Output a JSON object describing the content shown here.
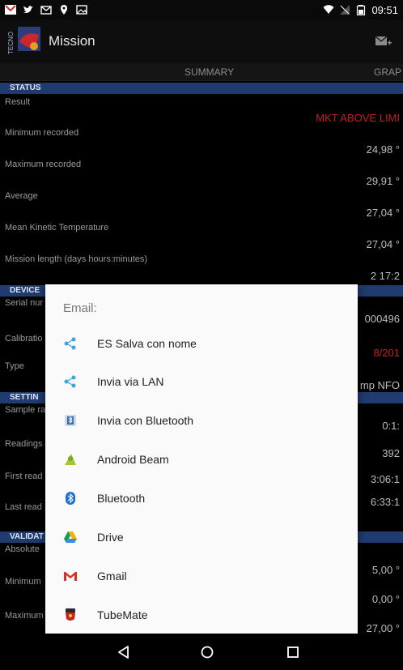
{
  "status_bar": {
    "time": "09:51",
    "left_icons": [
      "gmail-icon",
      "twitter-icon",
      "mail-icon",
      "location-pin-icon",
      "image-icon"
    ],
    "right_icons": [
      "wifi-icon",
      "no-signal-icon",
      "battery-icon"
    ]
  },
  "app_bar": {
    "title": "Mission",
    "logo_text": "TECNO"
  },
  "tabs": [
    "SUMMARY",
    "GRAP"
  ],
  "sections": {
    "status": {
      "header": "STATUS",
      "rows": [
        {
          "label": "Result",
          "value": "MKT ABOVE LIMI",
          "highlight": "red"
        },
        {
          "label": "Minimum recorded",
          "value": "24,98 °"
        },
        {
          "label": "Maximum recorded",
          "value": "29,91 °"
        },
        {
          "label": "Average",
          "value": "27,04 °"
        },
        {
          "label": "Mean Kinetic Temperature",
          "value": "27,04 °"
        },
        {
          "label": "Mission length (days hours:minutes)",
          "value": "2 17:2"
        }
      ]
    },
    "device": {
      "header": "DEVICE",
      "rows": [
        {
          "label": "Serial nur",
          "value": "000496"
        },
        {
          "label": "Calibratio",
          "value": "8/201",
          "highlight": "red"
        },
        {
          "label": "Type",
          "value": "mp NFO"
        }
      ]
    },
    "settings": {
      "header": "SETTIN",
      "rows": [
        {
          "label": "Sample ra",
          "value": "0:1:"
        },
        {
          "label": "Readings",
          "value": "392"
        },
        {
          "label": "First read",
          "value": "3:06:1"
        },
        {
          "label": "Last read",
          "value": "6:33:1"
        }
      ]
    },
    "validation": {
      "header": "VALIDAT",
      "rows": [
        {
          "label": "Absolute",
          "value": "5,00 °"
        },
        {
          "label": "Minimum",
          "value": "0,00 °"
        },
        {
          "label": "Maximum",
          "value": "27,00 °"
        }
      ]
    }
  },
  "dialog": {
    "title": "Email:",
    "items": [
      {
        "label": "ES Salva con nome",
        "icon": "share-icon"
      },
      {
        "label": "Invia via LAN",
        "icon": "share-icon"
      },
      {
        "label": "Invia con Bluetooth",
        "icon": "bluetooth-file-icon"
      },
      {
        "label": "Android Beam",
        "icon": "android-icon"
      },
      {
        "label": "Bluetooth",
        "icon": "bluetooth-icon"
      },
      {
        "label": "Drive",
        "icon": "drive-icon"
      },
      {
        "label": "Gmail",
        "icon": "gmail-icon"
      },
      {
        "label": "TubeMate",
        "icon": "tubemate-icon"
      }
    ]
  },
  "nav_bar": {
    "buttons": [
      "back-icon",
      "home-icon",
      "recents-icon"
    ]
  },
  "colors": {
    "section_header": "#1f3b6f",
    "alert_red": "#c6201f",
    "dialog_bg": "#fafafa"
  }
}
